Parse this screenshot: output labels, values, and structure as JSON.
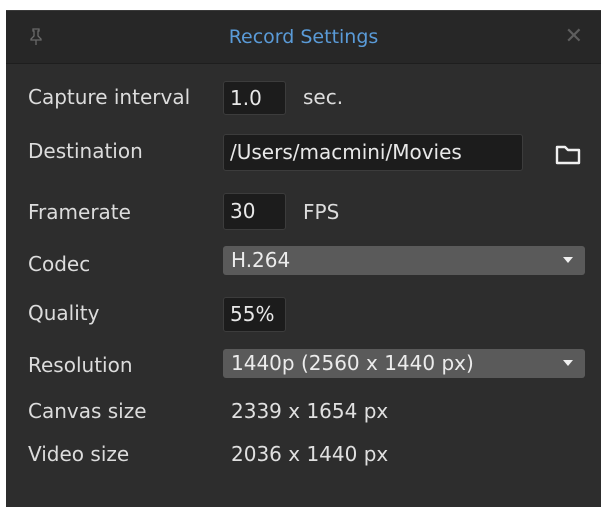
{
  "window": {
    "title": "Record Settings",
    "close_icon": "close-icon",
    "pin_icon": "pin-icon"
  },
  "capture_interval": {
    "label": "Capture interval",
    "value": "1.0",
    "unit": "sec."
  },
  "destination": {
    "label": "Destination",
    "value": "/Users/macmini/Movies",
    "icon": "folder-icon"
  },
  "framerate": {
    "label": "Framerate",
    "value": "30",
    "unit": "FPS"
  },
  "codec": {
    "label": "Codec",
    "selected": "H.264"
  },
  "quality": {
    "label": "Quality",
    "value": "55%"
  },
  "resolution": {
    "label": "Resolution",
    "selected": "1440p (2560 x 1440 px)"
  },
  "canvas_size": {
    "label": "Canvas size",
    "value": "2339 x 1654 px"
  },
  "video_size": {
    "label": "Video size",
    "value": "2036 x 1440 px"
  },
  "colors": {
    "title": "#5a9bd8",
    "panel_bg": "#2d2d2d",
    "field_bg": "#1c1c1c",
    "select_bg": "#5a5a5a"
  }
}
